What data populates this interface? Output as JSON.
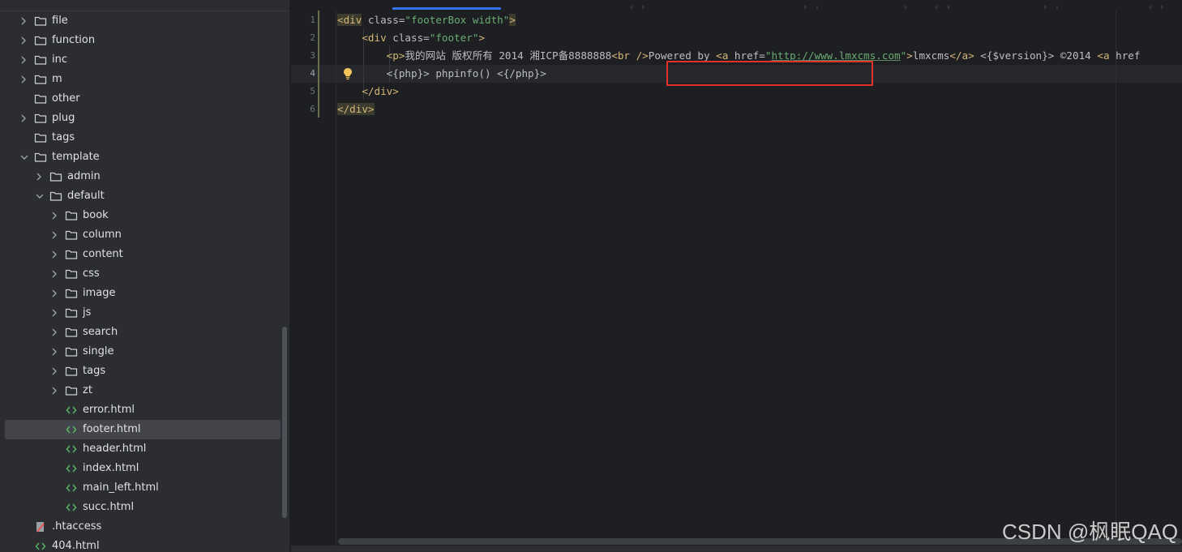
{
  "project_tree": {
    "items": [
      {
        "label": "file",
        "type": "folder",
        "depth": 1,
        "expandable": true,
        "expanded": false,
        "selected": false
      },
      {
        "label": "function",
        "type": "folder",
        "depth": 1,
        "expandable": true,
        "expanded": false,
        "selected": false
      },
      {
        "label": "inc",
        "type": "folder",
        "depth": 1,
        "expandable": true,
        "expanded": false,
        "selected": false
      },
      {
        "label": "m",
        "type": "folder",
        "depth": 1,
        "expandable": true,
        "expanded": false,
        "selected": false
      },
      {
        "label": "other",
        "type": "folder",
        "depth": 1,
        "expandable": false,
        "expanded": false,
        "selected": false
      },
      {
        "label": "plug",
        "type": "folder",
        "depth": 1,
        "expandable": true,
        "expanded": false,
        "selected": false
      },
      {
        "label": "tags",
        "type": "folder",
        "depth": 1,
        "expandable": false,
        "expanded": false,
        "selected": false
      },
      {
        "label": "template",
        "type": "folder",
        "depth": 1,
        "expandable": true,
        "expanded": true,
        "selected": false
      },
      {
        "label": "admin",
        "type": "folder",
        "depth": 2,
        "expandable": true,
        "expanded": false,
        "selected": false
      },
      {
        "label": "default",
        "type": "folder",
        "depth": 2,
        "expandable": true,
        "expanded": true,
        "selected": false
      },
      {
        "label": "book",
        "type": "folder",
        "depth": 3,
        "expandable": true,
        "expanded": false,
        "selected": false
      },
      {
        "label": "column",
        "type": "folder",
        "depth": 3,
        "expandable": true,
        "expanded": false,
        "selected": false
      },
      {
        "label": "content",
        "type": "folder",
        "depth": 3,
        "expandable": true,
        "expanded": false,
        "selected": false
      },
      {
        "label": "css",
        "type": "folder",
        "depth": 3,
        "expandable": true,
        "expanded": false,
        "selected": false
      },
      {
        "label": "image",
        "type": "folder",
        "depth": 3,
        "expandable": true,
        "expanded": false,
        "selected": false
      },
      {
        "label": "js",
        "type": "folder",
        "depth": 3,
        "expandable": true,
        "expanded": false,
        "selected": false
      },
      {
        "label": "search",
        "type": "folder",
        "depth": 3,
        "expandable": true,
        "expanded": false,
        "selected": false
      },
      {
        "label": "single",
        "type": "folder",
        "depth": 3,
        "expandable": true,
        "expanded": false,
        "selected": false
      },
      {
        "label": "tags",
        "type": "folder",
        "depth": 3,
        "expandable": true,
        "expanded": false,
        "selected": false
      },
      {
        "label": "zt",
        "type": "folder",
        "depth": 3,
        "expandable": true,
        "expanded": false,
        "selected": false
      },
      {
        "label": "error.html",
        "type": "html",
        "depth": 3,
        "expandable": false,
        "expanded": false,
        "selected": false
      },
      {
        "label": "footer.html",
        "type": "html",
        "depth": 3,
        "expandable": false,
        "expanded": false,
        "selected": true
      },
      {
        "label": "header.html",
        "type": "html",
        "depth": 3,
        "expandable": false,
        "expanded": false,
        "selected": false
      },
      {
        "label": "index.html",
        "type": "html",
        "depth": 3,
        "expandable": false,
        "expanded": false,
        "selected": false
      },
      {
        "label": "main_left.html",
        "type": "html",
        "depth": 3,
        "expandable": false,
        "expanded": false,
        "selected": false
      },
      {
        "label": "succ.html",
        "type": "html",
        "depth": 3,
        "expandable": false,
        "expanded": false,
        "selected": false
      },
      {
        "label": ".htaccess",
        "type": "config",
        "depth": 1,
        "expandable": false,
        "expanded": false,
        "selected": false
      },
      {
        "label": "404.html",
        "type": "html",
        "depth": 1,
        "expandable": false,
        "expanded": false,
        "selected": false
      }
    ]
  },
  "editor": {
    "current_line": 4,
    "lines": [
      {
        "num": "1",
        "tokens": [
          {
            "t": "<div",
            "c": "tg hl"
          },
          {
            "t": " class=",
            "c": "at"
          },
          {
            "t": "\"footerBox width\"",
            "c": "st"
          },
          {
            "t": ">",
            "c": "tg hl"
          }
        ]
      },
      {
        "num": "2",
        "tokens": [
          {
            "t": "    ",
            "c": "tx"
          },
          {
            "t": "<div",
            "c": "tg"
          },
          {
            "t": " class=",
            "c": "at"
          },
          {
            "t": "\"footer\"",
            "c": "st"
          },
          {
            "t": ">",
            "c": "tg"
          }
        ]
      },
      {
        "num": "3",
        "tokens": [
          {
            "t": "        ",
            "c": "tx"
          },
          {
            "t": "<p>",
            "c": "tg"
          },
          {
            "t": "我的网站 版权所有 2014 湘ICP备8888888",
            "c": "tx"
          },
          {
            "t": "<br />",
            "c": "tg"
          },
          {
            "t": "Powered by ",
            "c": "tx"
          },
          {
            "t": "<a",
            "c": "tg"
          },
          {
            "t": " href=",
            "c": "at"
          },
          {
            "t": "\"",
            "c": "st"
          },
          {
            "t": "http://www.lmxcms.com",
            "c": "lnk"
          },
          {
            "t": "\"",
            "c": "st"
          },
          {
            "t": ">",
            "c": "tg"
          },
          {
            "t": "lmxcms",
            "c": "tx"
          },
          {
            "t": "</a>",
            "c": "tg"
          },
          {
            "t": " <{$version}> ©2014 ",
            "c": "tx"
          },
          {
            "t": "<a",
            "c": "tg"
          },
          {
            "t": " href",
            "c": "at"
          }
        ]
      },
      {
        "num": "4",
        "tokens": [
          {
            "t": "        <{php}> phpinfo() <{/php}>",
            "c": "tx"
          }
        ]
      },
      {
        "num": "5",
        "tokens": [
          {
            "t": "    ",
            "c": "tx"
          },
          {
            "t": "</div>",
            "c": "tg"
          }
        ]
      },
      {
        "num": "6",
        "tokens": [
          {
            "t": "</div>",
            "c": "tg hl"
          }
        ]
      }
    ]
  },
  "watermark": {
    "text": "CSDN @枫眠QAQ"
  },
  "colors": {
    "tag": "#d5b778",
    "string": "#6aab73",
    "attribute": "#bcbec4",
    "text": "#bcbec4",
    "highlight_box": "#e0322a",
    "tab_underline": "#3574f0",
    "folder_icon": "#ced0d6",
    "html_icon": "#5fb865"
  }
}
